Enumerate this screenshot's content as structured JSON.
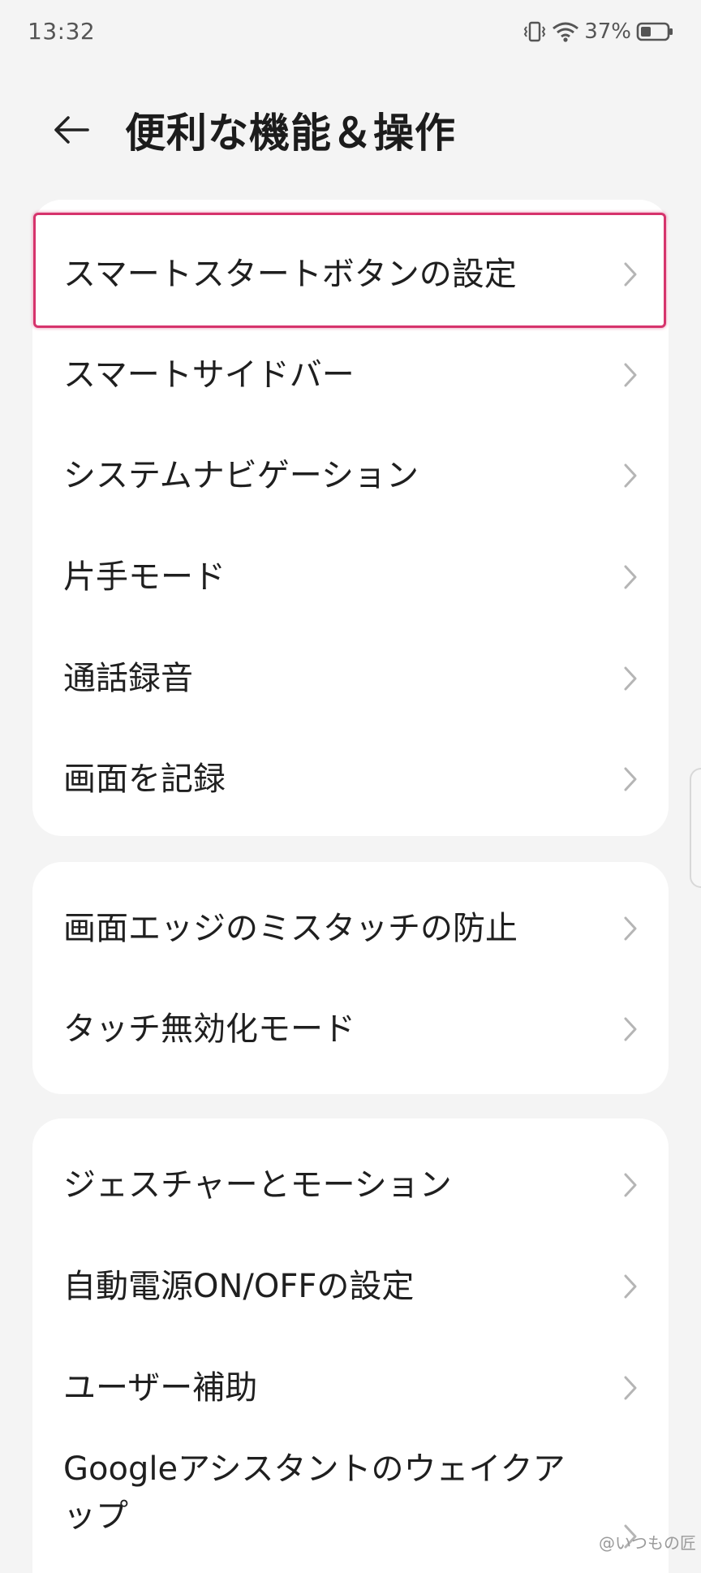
{
  "status_bar": {
    "time": "13:32",
    "battery": "37%"
  },
  "header": {
    "title": "便利な機能＆操作"
  },
  "groups": [
    {
      "items": [
        {
          "label": "スマートスタートボタンの設定"
        },
        {
          "label": "スマートサイドバー"
        },
        {
          "label": "システムナビゲーション"
        },
        {
          "label": "片手モード"
        },
        {
          "label": "通話録音"
        },
        {
          "label": "画面を記録"
        }
      ]
    },
    {
      "items": [
        {
          "label": "画面エッジのミスタッチの防止"
        },
        {
          "label": "タッチ無効化モード"
        }
      ]
    },
    {
      "items": [
        {
          "label": "ジェスチャーとモーション"
        },
        {
          "label": "自動電源ON/OFFの設定"
        },
        {
          "label": "ユーザー補助"
        },
        {
          "label": "Googleアシスタントのウェイクアップ"
        }
      ]
    }
  ],
  "watermark": "@いつもの匠",
  "colors": {
    "highlight": "#d6336c",
    "background": "#f4f4f4",
    "card": "#ffffff"
  }
}
